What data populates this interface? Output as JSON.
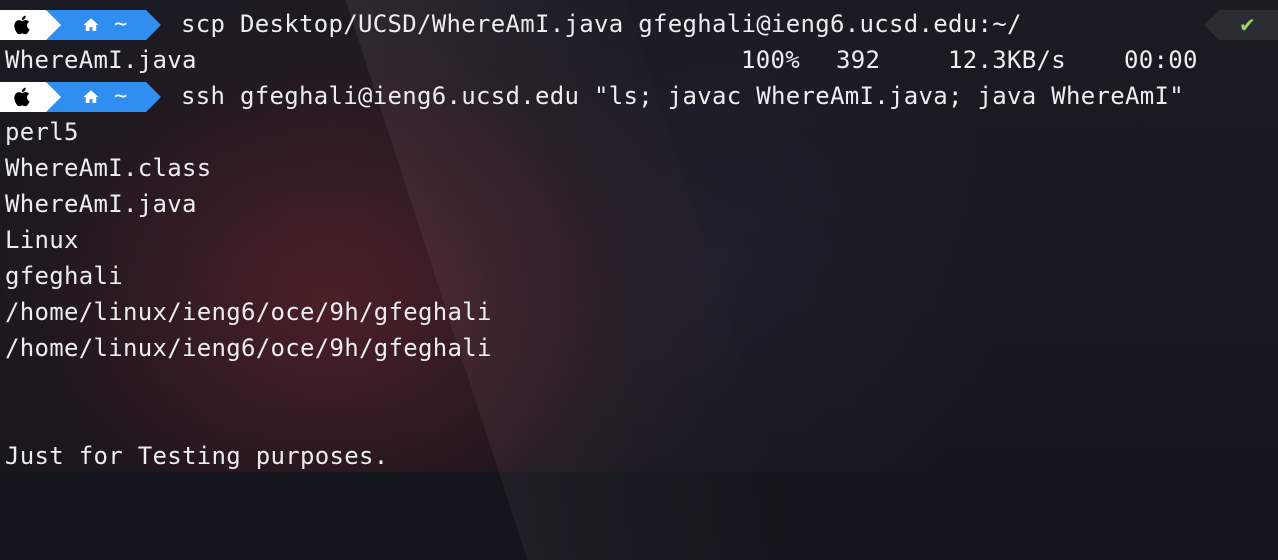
{
  "prompt": {
    "home_tilde": "~"
  },
  "commands": {
    "scp": "scp Desktop/UCSD/WhereAmI.java gfeghali@ieng6.ucsd.edu:~/",
    "ssh": "ssh gfeghali@ieng6.ucsd.edu \"ls; javac WhereAmI.java; java WhereAmI\""
  },
  "status": {
    "check": "✔"
  },
  "transfer": {
    "file": "WhereAmI.java",
    "percent": "100%",
    "bytes": "392",
    "rate": "12.3KB/s",
    "eta": "00:00"
  },
  "output": {
    "lines": [
      "perl5",
      "WhereAmI.class",
      "WhereAmI.java",
      "Linux",
      "gfeghali",
      "/home/linux/ieng6/oce/9h/gfeghali",
      "/home/linux/ieng6/oce/9h/gfeghali",
      "",
      "",
      "Just for Testing purposes."
    ]
  },
  "colors": {
    "background": "#14151c",
    "text": "#ecedf0",
    "prompt_apple_bg": "#ffffff",
    "prompt_home_bg": "#2f8ef0",
    "status_bg": "#2b2d33",
    "status_ok": "#9ed36a"
  },
  "icons": {
    "apple": "apple-logo-icon",
    "home": "home-icon",
    "status": "checkmark-icon"
  }
}
